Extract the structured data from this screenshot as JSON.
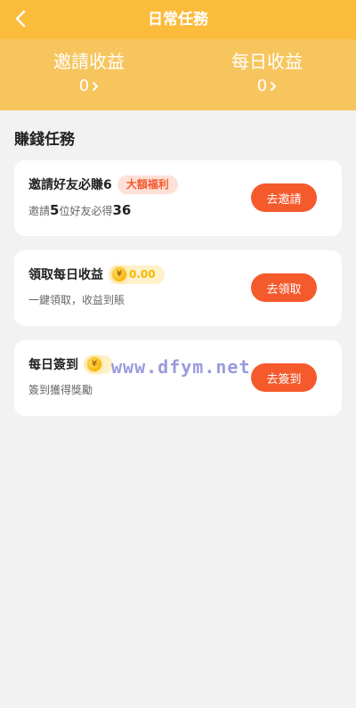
{
  "header": {
    "title": "日常任務"
  },
  "summary": {
    "invite_label": "邀請收益",
    "invite_value": "0",
    "daily_label": "每日收益",
    "daily_value": "0"
  },
  "section_title": "賺錢任務",
  "tasks": [
    {
      "title": "邀請好友必賺6",
      "badge": "大額福利",
      "sub_prefix": "邀請",
      "sub_number": "5",
      "sub_middle": "位好友必得",
      "sub_reward": "36",
      "button": "去邀請"
    },
    {
      "title": "領取每日收益",
      "coin_amount": "0.00",
      "sub": "一鍵領取，收益到賬",
      "button": "去領取"
    },
    {
      "title": "每日簽到",
      "coin_amount": "",
      "sub": "簽到獲得獎勵",
      "button": "去簽到"
    }
  ],
  "icons": {
    "back": "chevron-left-icon",
    "more": "chevron-right-icon",
    "coin": "coin-icon"
  },
  "colors": {
    "header": "#fbbc3c",
    "summary": "#f7c55e",
    "button": "#f55a2c",
    "badge_bg": "#fde0d6",
    "badge_text": "#f25a30"
  },
  "watermark": "www.dfym.net"
}
